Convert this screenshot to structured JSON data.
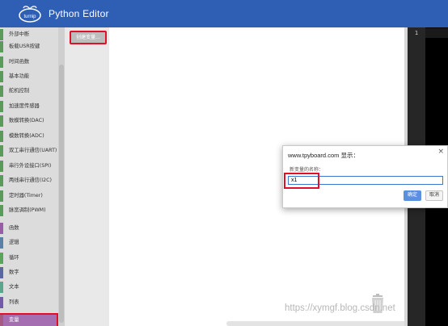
{
  "header": {
    "logo_text": "turnip",
    "title": "Python Editor"
  },
  "sidebar": {
    "items": [
      {
        "label": "外部中断",
        "stripe": "#5a9b5a"
      },
      {
        "label": "板载USR按键",
        "stripe": "#5a9b5a"
      },
      {
        "label": "时间函数",
        "stripe": "#5a9b5a"
      },
      {
        "label": "基本功能",
        "stripe": "#5a9b5a"
      },
      {
        "label": "舵机控制",
        "stripe": "#5a9b5a"
      },
      {
        "label": "加速度传感器",
        "stripe": "#5a9b5a"
      },
      {
        "label": "数模转换(DAC)",
        "stripe": "#5a9b5a"
      },
      {
        "label": "模数转换(ADC)",
        "stripe": "#5a9b5a"
      },
      {
        "label": "双工串行通信(UART)",
        "stripe": "#5a9b5a"
      },
      {
        "label": "串行外设接口(SPI)",
        "stripe": "#5a9b5a"
      },
      {
        "label": "两线串行通信(I2C)",
        "stripe": "#5a9b5a"
      },
      {
        "label": "定时器(Timer)",
        "stripe": "#5a9b5a"
      },
      {
        "label": "脉宽调制(PWM)",
        "stripe": "#5a9b5a"
      },
      {
        "label": "函数",
        "stripe": "#9a5ca6"
      },
      {
        "label": "逻辑",
        "stripe": "#5b80a5"
      },
      {
        "label": "循环",
        "stripe": "#5ba55b"
      },
      {
        "label": "数字",
        "stripe": "#5b67a5"
      },
      {
        "label": "文本",
        "stripe": "#5ba58c"
      },
      {
        "label": "列表",
        "stripe": "#745ba5"
      },
      {
        "label": "变量",
        "stripe": "#a55b80"
      }
    ]
  },
  "flyout": {
    "create_variable": "创建变量..."
  },
  "code_panel": {
    "line_number": "1"
  },
  "dialog": {
    "title": "www.tpyboard.com 显示：",
    "close": "×",
    "message": "新变量的名称：",
    "input_value": "x1",
    "ok_label": "确定",
    "cancel_label": "取消"
  },
  "watermark": "https://xymgf.blog.csdn.net",
  "colors": {
    "header": "#2f5fb5",
    "active_category": "#a56eb1",
    "highlight_box": "#e0102a",
    "ok_button": "#5b8fe0"
  }
}
